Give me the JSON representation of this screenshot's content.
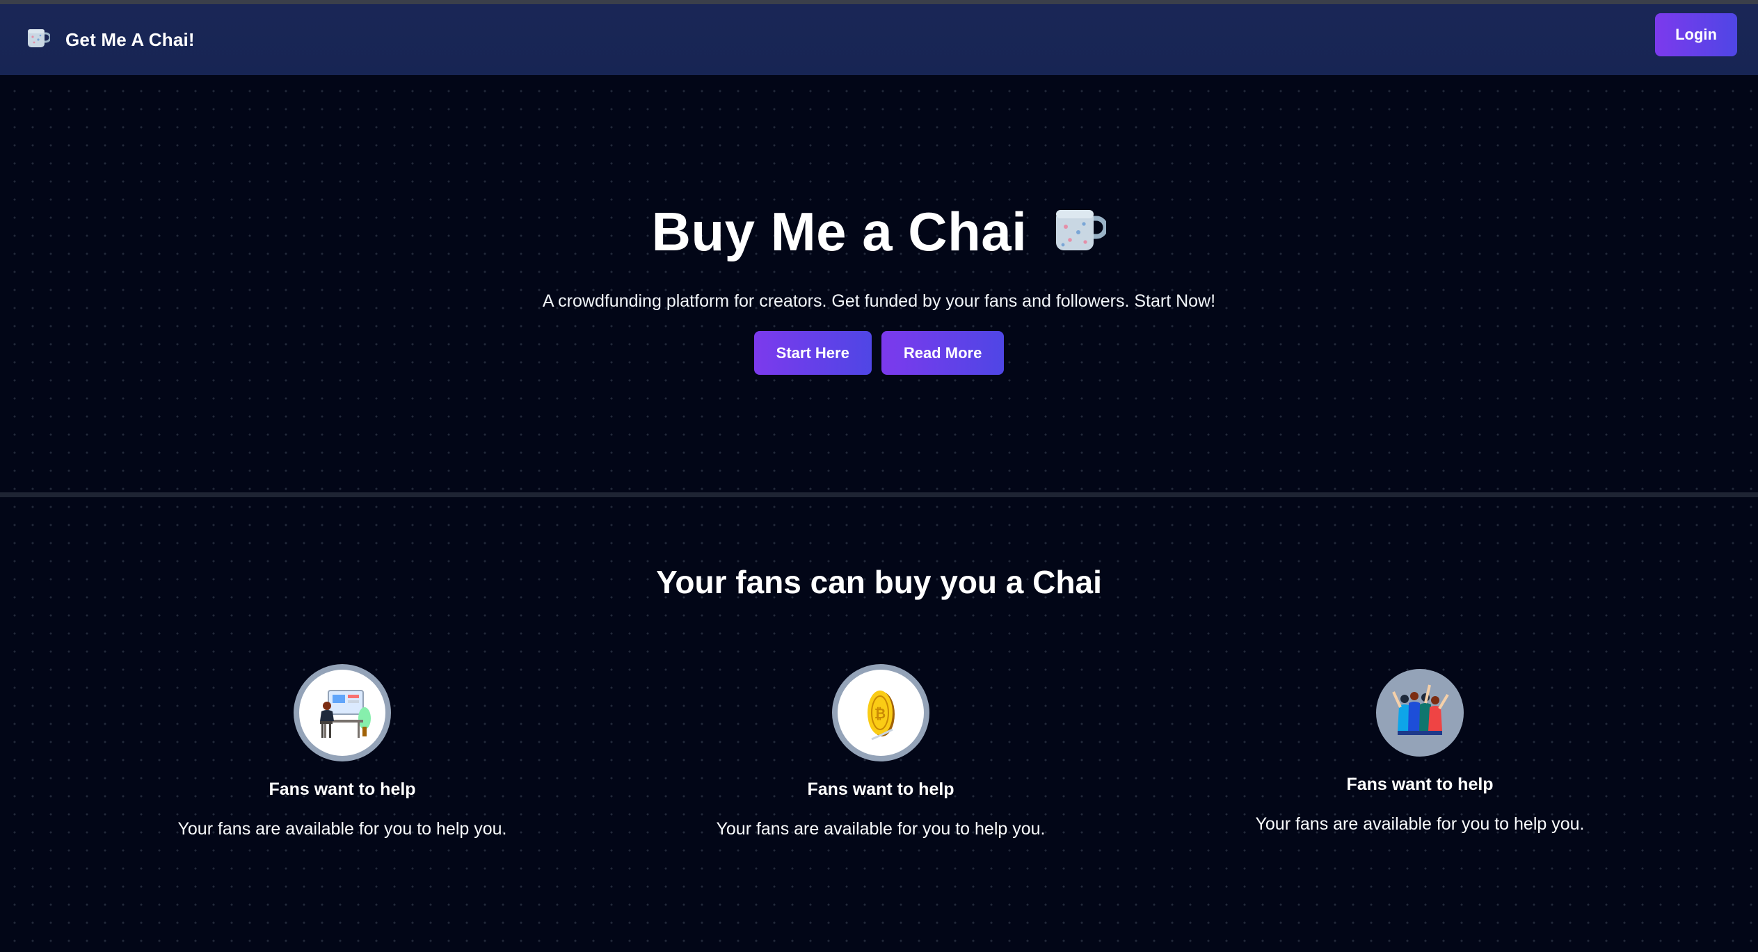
{
  "navbar": {
    "brand_icon": "tea-cup-icon",
    "brand_title": "Get Me A Chai!",
    "login_label": "Login"
  },
  "hero": {
    "title": "Buy Me a Chai",
    "title_icon": "tea-cup-icon",
    "subtitle": "A crowdfunding platform for creators. Get funded by your fans and followers. Start Now!",
    "buttons": [
      {
        "label": "Start Here"
      },
      {
        "label": "Read More"
      }
    ]
  },
  "section": {
    "title": "Your fans can buy you a Chai",
    "features": [
      {
        "icon": "person-at-desk-icon",
        "title": "Fans want to help",
        "description": "Your fans are available for you to help you."
      },
      {
        "icon": "gold-coin-icon",
        "title": "Fans want to help",
        "description": "Your fans are available for you to help you."
      },
      {
        "icon": "group-of-people-icon",
        "title": "Fans want to help",
        "description": "Your fans are available for you to help you."
      }
    ]
  },
  "colors": {
    "background": "#020617",
    "navbar": "#172554",
    "accent_start": "#7c3aed",
    "accent_end": "#4f46e5"
  }
}
